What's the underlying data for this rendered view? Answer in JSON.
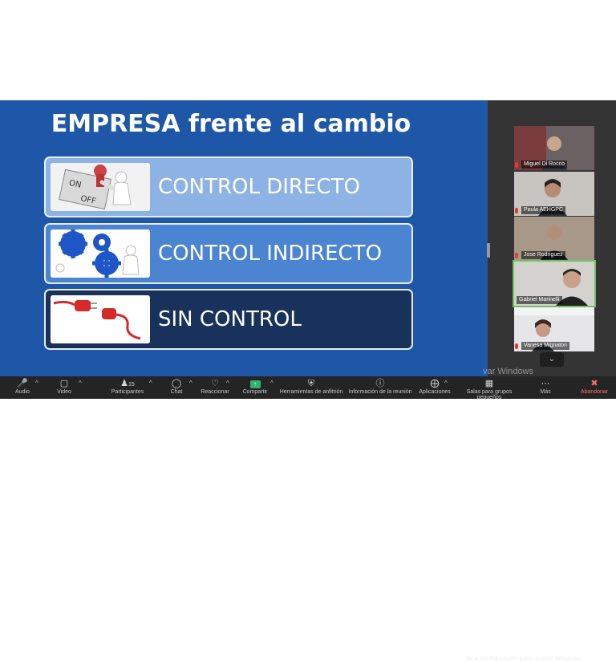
{
  "slide": {
    "title": "EMPRESA frente al cambio",
    "items": [
      {
        "label": "CONTROL DIRECTO",
        "image": "on-off-switch"
      },
      {
        "label": "CONTROL INDIRECTO",
        "image": "gears"
      },
      {
        "label": "SIN CONTROL",
        "image": "unplugged-cable"
      }
    ]
  },
  "participants": [
    {
      "name": "Miguel Di Rocco",
      "muted": true
    },
    {
      "name": "Paula AEHGPC",
      "muted": true
    },
    {
      "name": "Jose Rodriguez",
      "muted": true
    },
    {
      "name": "Gabriel Marinelli",
      "muted": false
    },
    {
      "name": "Vanesa Mignaton",
      "muted": true
    }
  ],
  "toolbar": {
    "audio": "Audio",
    "video": "Video",
    "participants": "Participantes",
    "participants_count": "15",
    "chat": "Chat",
    "react": "Reaccionar",
    "share": "Compartir",
    "host_tools": "Herramientas de anfitrión",
    "meeting_info": "Información de la reunión",
    "apps": "Aplicaciones",
    "breakout": "Salas para grupos pequeños",
    "more": "Más",
    "leave": "Abandonar"
  },
  "watermark": {
    "line1": "var Windows",
    "line2": "Ve a configuración para activar Windows"
  },
  "colors": {
    "slide_bg": "#1f57a8",
    "box1": "#8cb3e3",
    "box2": "#4b84d0",
    "box3": "#18325b",
    "active_speaker": "#6fc25f",
    "share_green": "#2fb36b"
  }
}
